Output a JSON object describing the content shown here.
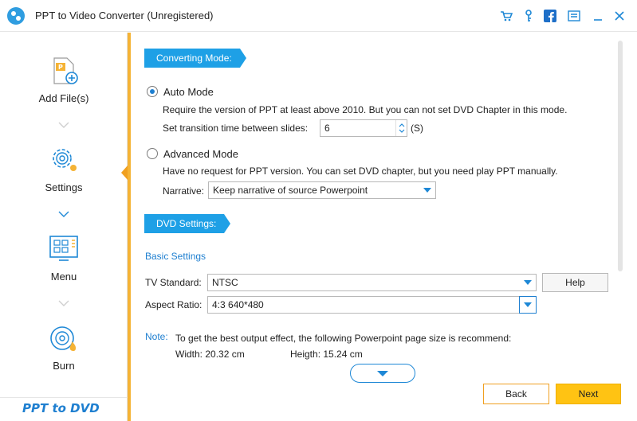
{
  "window": {
    "title": "PPT to Video Converter (Unregistered)",
    "toolbar_icons": [
      "cart-icon",
      "key-icon",
      "facebook-icon",
      "feedback-icon",
      "minimize-icon",
      "close-icon"
    ]
  },
  "sidebar": {
    "items": [
      {
        "label": "Add File(s)",
        "icon": "add-file-icon"
      },
      {
        "label": "Settings",
        "icon": "settings-icon"
      },
      {
        "label": "Menu",
        "icon": "menu-icon"
      },
      {
        "label": "Burn",
        "icon": "burn-icon"
      }
    ],
    "brand": "PPT to DVD",
    "active": "Settings"
  },
  "converting": {
    "section_label": "Converting Mode:",
    "auto": {
      "label": "Auto Mode",
      "selected": true,
      "description": "Require the version of PPT at least above 2010. But you can not set DVD Chapter in this mode.",
      "transition_label": "Set transition time between slides:",
      "transition_value": "6",
      "transition_unit": "(S)"
    },
    "advanced": {
      "label": "Advanced Mode",
      "selected": false,
      "description": "Have no request for PPT version. You can set DVD chapter, but you need play PPT manually.",
      "narrative_label": "Narrative:",
      "narrative_value": "Keep narrative of source Powerpoint"
    }
  },
  "dvd": {
    "section_label": "DVD Settings:",
    "basic_label": "Basic Settings",
    "tv_standard_label": "TV Standard:",
    "tv_standard_value": "NTSC",
    "help_label": "Help",
    "aspect_label": "Aspect Ratio:",
    "aspect_value": "4:3 640*480",
    "note_label": "Note:",
    "note_text": "To get the best output effect, the following Powerpoint page size is recommend:",
    "width_text": "Width: 20.32 cm",
    "height_text": "Heigth: 15.24 cm"
  },
  "footer": {
    "back_label": "Back",
    "next_label": "Next"
  },
  "colors": {
    "accent_blue": "#1ea0e6",
    "accent_orange": "#f5b335",
    "next_yellow": "#ffc313"
  }
}
